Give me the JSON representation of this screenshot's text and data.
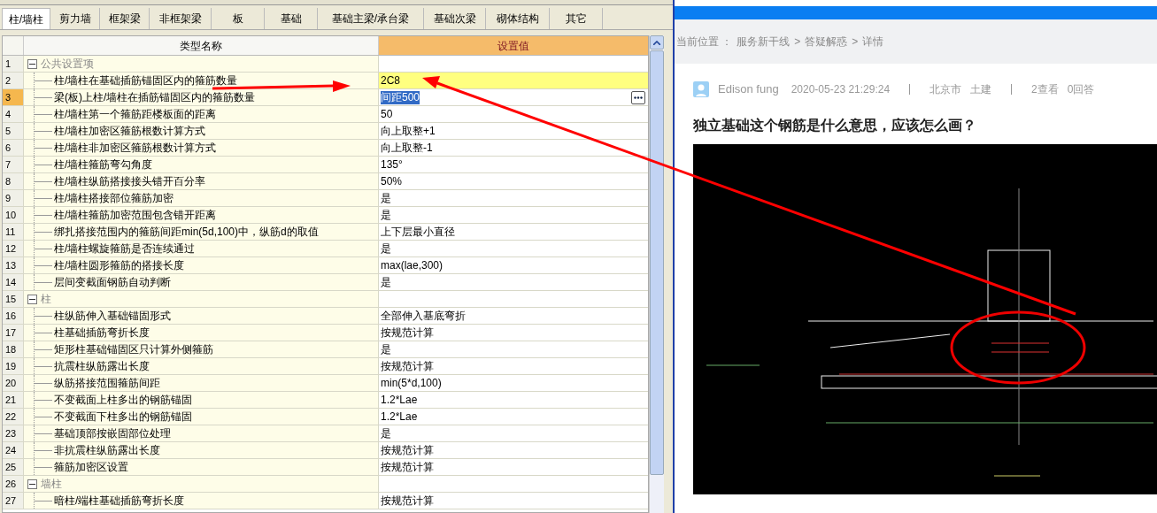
{
  "tabs": [
    {
      "label": "柱/墙柱",
      "selected": true
    },
    {
      "label": "剪力墙",
      "selected": false
    },
    {
      "label": "框架梁",
      "selected": false
    },
    {
      "label": "非框架梁",
      "selected": false
    },
    {
      "label": "板",
      "selected": false
    },
    {
      "label": "基础",
      "selected": false
    },
    {
      "label": "基础主梁/承台梁",
      "selected": false
    },
    {
      "label": "基础次梁",
      "selected": false
    },
    {
      "label": "砌体结构",
      "selected": false
    },
    {
      "label": "其它",
      "selected": false
    }
  ],
  "table": {
    "columns": [
      "类型名称",
      "设置值"
    ],
    "groups": [
      {
        "number": "1",
        "name": "公共设置项",
        "expanded": true,
        "children": [
          {
            "number": "2",
            "name": "柱/墙柱在基础插筋锚固区内的箍筋数量",
            "value": "2C8",
            "selected": false,
            "highlighted": true
          },
          {
            "number": "3",
            "name": "梁(板)上柱/墙柱在插筋锚固区内的箍筋数量",
            "value": "间距500",
            "selected": true,
            "highlighted": false
          },
          {
            "number": "4",
            "name": "柱/墙柱第一个箍筋距楼板面的距离",
            "value": "50",
            "selected": false,
            "highlighted": false
          },
          {
            "number": "5",
            "name": "柱/墙柱加密区箍筋根数计算方式",
            "value": "向上取整+1",
            "selected": false,
            "highlighted": false
          },
          {
            "number": "6",
            "name": "柱/墙柱非加密区箍筋根数计算方式",
            "value": "向上取整-1",
            "selected": false,
            "highlighted": false
          },
          {
            "number": "7",
            "name": "柱/墙柱箍筋弯勾角度",
            "value": "135°",
            "selected": false,
            "highlighted": false
          },
          {
            "number": "8",
            "name": "柱/墙柱纵筋搭接接头错开百分率",
            "value": "50%",
            "selected": false,
            "highlighted": false
          },
          {
            "number": "9",
            "name": "柱/墙柱搭接部位箍筋加密",
            "value": "是",
            "selected": false,
            "highlighted": false
          },
          {
            "number": "10",
            "name": "柱/墙柱箍筋加密范围包含错开距离",
            "value": "是",
            "selected": false,
            "highlighted": false
          },
          {
            "number": "11",
            "name": "绑扎搭接范围内的箍筋间距min(5d,100)中，纵筋d的取值",
            "value": "上下层最小直径",
            "selected": false,
            "highlighted": false
          },
          {
            "number": "12",
            "name": "柱/墙柱螺旋箍筋是否连续通过",
            "value": "是",
            "selected": false,
            "highlighted": false
          },
          {
            "number": "13",
            "name": "柱/墙柱圆形箍筋的搭接长度",
            "value": "max(lae,300)",
            "selected": false,
            "highlighted": false
          },
          {
            "number": "14",
            "name": "层间变截面钢筋自动判断",
            "value": "是",
            "selected": false,
            "highlighted": false
          }
        ]
      },
      {
        "number": "15",
        "name": "柱",
        "expanded": true,
        "children": [
          {
            "number": "16",
            "name": "柱纵筋伸入基础锚固形式",
            "value": "全部伸入基底弯折",
            "selected": false,
            "highlighted": false
          },
          {
            "number": "17",
            "name": "柱基础插筋弯折长度",
            "value": "按规范计算",
            "selected": false,
            "highlighted": false
          },
          {
            "number": "18",
            "name": "矩形柱基础锚固区只计算外侧箍筋",
            "value": "是",
            "selected": false,
            "highlighted": false
          },
          {
            "number": "19",
            "name": "抗震柱纵筋露出长度",
            "value": "按规范计算",
            "selected": false,
            "highlighted": false
          },
          {
            "number": "20",
            "name": "纵筋搭接范围箍筋间距",
            "value": "min(5*d,100)",
            "selected": false,
            "highlighted": false
          },
          {
            "number": "21",
            "name": "不变截面上柱多出的钢筋锚固",
            "value": "1.2*Lae",
            "selected": false,
            "highlighted": false
          },
          {
            "number": "22",
            "name": "不变截面下柱多出的钢筋锚固",
            "value": "1.2*Lae",
            "selected": false,
            "highlighted": false
          },
          {
            "number": "23",
            "name": "基础顶部按嵌固部位处理",
            "value": "是",
            "selected": false,
            "highlighted": false
          },
          {
            "number": "24",
            "name": "非抗震柱纵筋露出长度",
            "value": "按规范计算",
            "selected": false,
            "highlighted": false
          },
          {
            "number": "25",
            "name": "箍筋加密区设置",
            "value": "按规范计算",
            "selected": false,
            "highlighted": false
          }
        ]
      },
      {
        "number": "26",
        "name": "墙柱",
        "expanded": true,
        "children": [
          {
            "number": "27",
            "name": "暗柱/端柱基础插筋弯折长度",
            "value": "按规范计算",
            "selected": false,
            "highlighted": false
          }
        ]
      }
    ]
  },
  "breadcrumb": [
    "当前位置 ：",
    "服务新干线",
    ">",
    "答疑解惑",
    ">",
    "详情"
  ],
  "post": {
    "author": "Edison fung",
    "date": "2020-05-23 21:29:24",
    "region": "北京市",
    "category": "土建",
    "views": "2查看",
    "answers": "0回答",
    "title": "独立基础这个钢筋是什么意思，应该怎么画？"
  }
}
